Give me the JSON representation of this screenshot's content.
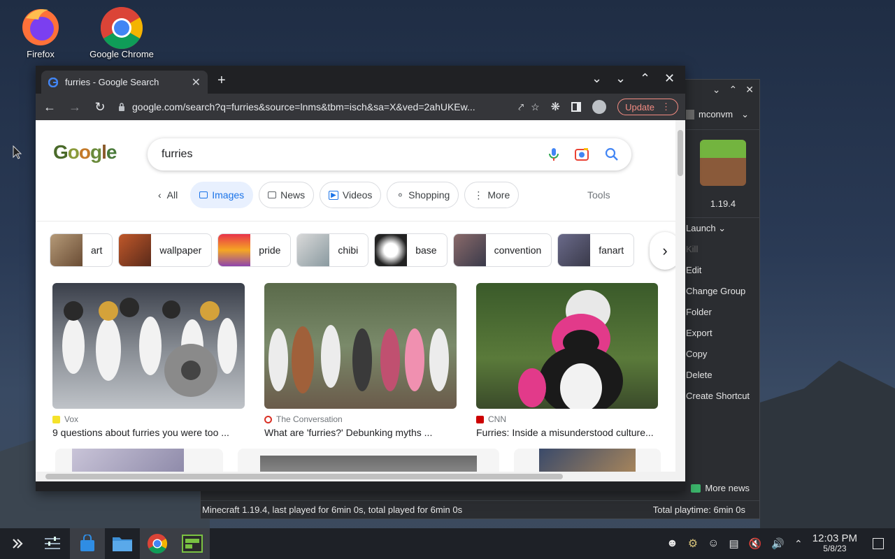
{
  "desktop": {
    "icons": [
      {
        "label": "Firefox"
      },
      {
        "label": "Google Chrome"
      }
    ]
  },
  "launcher": {
    "account": "mconvm",
    "instance_version": "1.19.4",
    "menu": [
      "Launch",
      "Kill",
      "Edit",
      "Change Group",
      "Folder",
      "Export",
      "Copy",
      "Delete",
      "Create Shortcut"
    ],
    "more_news": "More news",
    "status_left": "Minecraft 1.19.4, last played for 6min 0s, total played for 6min 0s",
    "status_right": "Total playtime: 6min 0s"
  },
  "chrome": {
    "tab_title": "furries - Google Search",
    "url": "google.com/search?q=furries&source=lnms&tbm=isch&sa=X&ved=2ahUKEw...",
    "update_label": "Update",
    "search": {
      "logo": "Google",
      "query": "furries"
    },
    "tabs": [
      {
        "label": "All"
      },
      {
        "label": "Images"
      },
      {
        "label": "News"
      },
      {
        "label": "Videos"
      },
      {
        "label": "Shopping"
      },
      {
        "label": "More"
      }
    ],
    "tools_label": "Tools",
    "suggestions": [
      "art",
      "wallpaper",
      "pride",
      "chibi",
      "base",
      "convention",
      "fanart"
    ],
    "results": [
      {
        "source": "Vox",
        "title": "9 questions about furries you were too ..."
      },
      {
        "source": "The Conversation",
        "title": "What are 'furries?' Debunking myths ..."
      },
      {
        "source": "CNN",
        "title": "Furries: Inside a misunderstood culture..."
      }
    ]
  },
  "taskbar": {
    "time": "12:03 PM",
    "date": "5/8/23"
  },
  "colors": {
    "google_blue": "#1a73e8",
    "update_red": "#f28b82",
    "chrome_dark": "#202124"
  }
}
